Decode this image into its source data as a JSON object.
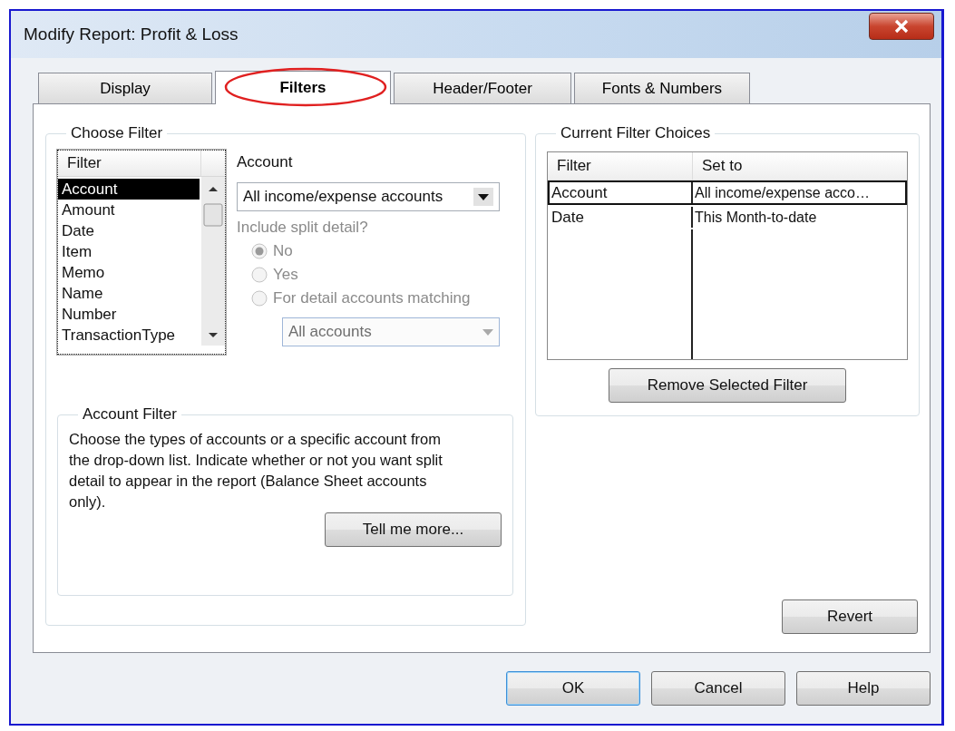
{
  "window": {
    "title": "Modify Report: Profit & Loss"
  },
  "tabs": [
    {
      "label": "Display",
      "selected": false,
      "circled": false
    },
    {
      "label": "Filters",
      "selected": true,
      "circled": true
    },
    {
      "label": "Header/Footer",
      "selected": false,
      "circled": false
    },
    {
      "label": "Fonts & Numbers",
      "selected": false,
      "circled": false
    }
  ],
  "choose_filter": {
    "title": "Choose Filter",
    "list": {
      "header": "Filter",
      "items": [
        {
          "label": "Account",
          "selected": true
        },
        {
          "label": "Amount",
          "selected": false
        },
        {
          "label": "Date",
          "selected": false
        },
        {
          "label": "Item",
          "selected": false
        },
        {
          "label": "Memo",
          "selected": false
        },
        {
          "label": "Name",
          "selected": false
        },
        {
          "label": "Number",
          "selected": false
        },
        {
          "label": "TransactionType",
          "selected": false
        }
      ]
    },
    "account": {
      "label": "Account",
      "dropdown": {
        "value": "All income/expense accounts"
      },
      "split_label": "Include split detail?",
      "disabled": true,
      "options": [
        {
          "label": "No",
          "selected": true
        },
        {
          "label": "Yes",
          "selected": false
        },
        {
          "label": "For detail accounts matching",
          "selected": false
        }
      ],
      "match_dropdown": {
        "value": "All accounts",
        "disabled": true
      }
    }
  },
  "account_filter": {
    "title": "Account Filter",
    "text": "Choose the types of accounts or a specific account from the drop-down list. Indicate whether or not you want split detail to appear in the report (Balance Sheet accounts only).",
    "button": "Tell me more..."
  },
  "current_filters": {
    "title": "Current Filter Choices",
    "columns": [
      "Filter",
      "Set to"
    ],
    "rows": [
      {
        "filter": "Account",
        "set_to": "All income/expense acco…",
        "selected": true
      },
      {
        "filter": "Date",
        "set_to": "This Month-to-date",
        "selected": false
      }
    ],
    "button": "Remove Selected Filter"
  },
  "revert_button": "Revert",
  "buttons": [
    {
      "label": "OK",
      "default": true
    },
    {
      "label": "Cancel",
      "default": false
    },
    {
      "label": "Help",
      "default": false
    }
  ]
}
